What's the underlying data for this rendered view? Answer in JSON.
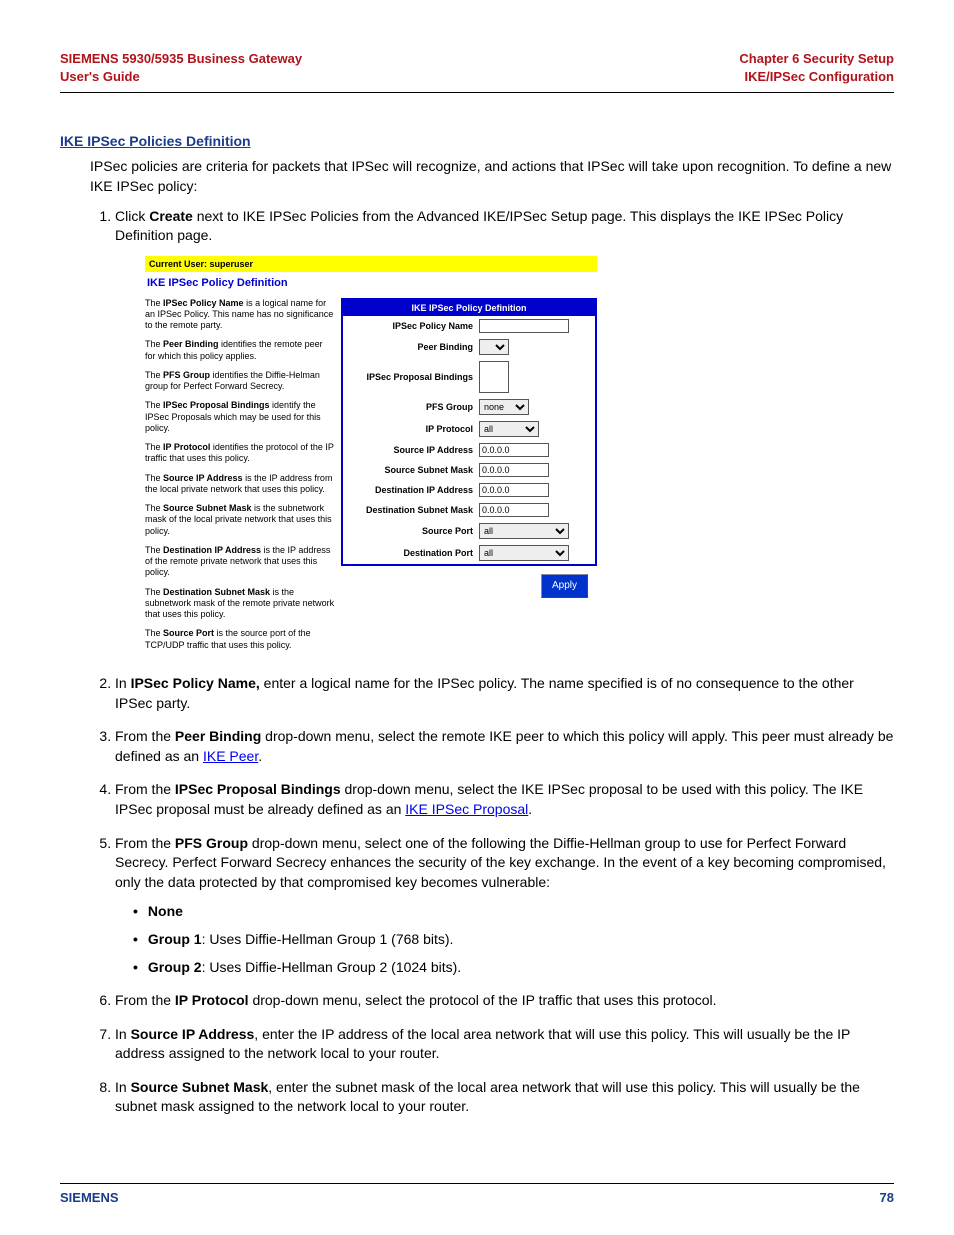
{
  "header": {
    "left_line1": "SIEMENS 5930/5935 Business Gateway",
    "left_line2": "User's Guide",
    "right_line1": "Chapter 6  Security Setup",
    "right_line2": "IKE/IPSec Configuration"
  },
  "section_heading": "IKE IPSec Policies Definition",
  "intro_para": "IPSec policies are criteria for packets that IPSec will recognize, and actions that IPSec will take upon recognition. To define a new IKE IPSec policy:",
  "steps": {
    "s1_a": "Click ",
    "s1_b": "Create",
    "s1_c": " next to IKE IPSec Policies from the Advanced IKE/IPSec Setup page. This displays the IKE IPSec Policy Definition page.",
    "s2_a": "In ",
    "s2_b": "IPSec Policy Name,",
    "s2_c": " enter a logical name for the IPSec policy. The name specified is of no consequence to the other IPSec party.",
    "s3_a": "From the ",
    "s3_b": "Peer Binding",
    "s3_c": " drop-down menu, select the remote IKE peer to which this policy will apply. This peer must already be defined as an ",
    "s3_link": "IKE Peer",
    "s3_d": ".",
    "s4_a": "From the ",
    "s4_b": "IPSec Proposal Bindings",
    "s4_c": " drop-down menu, select the IKE IPSec proposal to be used with this policy. The IKE IPSec proposal must be already defined as an ",
    "s4_link": "IKE IPSec Proposal",
    "s4_d": ".",
    "s5_a": "From the ",
    "s5_b": "PFS Group",
    "s5_c": " drop-down menu, select one of the following the Diffie-Hellman group to use for Perfect Forward Secrecy. Perfect Forward Secrecy enhances the security of the key exchange. In the event of a key becoming compromised, only the data protected by that compromised key becomes vulnerable:",
    "s5_sub": {
      "b1": "None",
      "b2a": "Group 1",
      "b2b": ": Uses Diffie-Hellman Group 1 (768 bits).",
      "b3a": "Group 2",
      "b3b": ": Uses Diffie-Hellman Group 2 (1024 bits)."
    },
    "s6_a": "From the ",
    "s6_b": "IP Protocol",
    "s6_c": " drop-down menu, select the protocol of the IP traffic that uses this protocol.",
    "s7_a": "In ",
    "s7_b": "Source IP Address",
    "s7_c": ", enter the IP address of the local area network that will use this policy. This will usually be the IP address assigned to the network local to your router.",
    "s8_a": "In ",
    "s8_b": "Source Subnet Mask",
    "s8_c": ", enter the subnet mask of the local area network that will use this policy. This will usually be the subnet mask assigned to the network local to your router."
  },
  "screenshot": {
    "userbar": "Current User: superuser",
    "title": "IKE IPSec Policy Definition",
    "panel_head": "IKE IPSec Policy Definition",
    "help": {
      "p1a": "The ",
      "p1b": "IPSec Policy Name",
      "p1c": " is a logical name for an IPSec Policy. This name has no significance to the remote party.",
      "p2a": "The ",
      "p2b": "Peer Binding",
      "p2c": " identifies the remote peer for which this policy applies.",
      "p3a": "The ",
      "p3b": "PFS Group",
      "p3c": " identifies the Diffie-Helman group for Perfect Forward Secrecy.",
      "p4a": "The ",
      "p4b": "IPSec Proposal Bindings",
      "p4c": " identify the IPSec Proposals which may be used for this policy.",
      "p5a": "The ",
      "p5b": "IP Protocol",
      "p5c": " identifies the protocol of the IP traffic that uses this policy.",
      "p6a": "The ",
      "p6b": "Source IP Address",
      "p6c": " is the IP address from the local private network that uses this policy.",
      "p7a": "The ",
      "p7b": "Source Subnet Mask",
      "p7c": " is the subnetwork mask of the local private network that uses this policy.",
      "p8a": "The ",
      "p8b": "Destination IP Address",
      "p8c": " is the IP address of the remote private network that uses this policy.",
      "p9a": "The ",
      "p9b": "Destination Subnet Mask",
      "p9c": " is the subnetwork mask of the remote private network that uses this policy.",
      "p10a": "The ",
      "p10b": "Source Port",
      "p10c": " is the source port of the TCP/UDP traffic that uses this policy."
    },
    "form": {
      "policy_name_label": "IPSec Policy Name",
      "policy_name_value": "",
      "peer_binding_label": "Peer Binding",
      "peer_binding_value": "",
      "proposal_bindings_label": "IPSec Proposal Bindings",
      "pfs_group_label": "PFS Group",
      "pfs_group_value": "none",
      "ip_protocol_label": "IP Protocol",
      "ip_protocol_value": "all",
      "src_ip_label": "Source IP Address",
      "src_ip_value": "0.0.0.0",
      "src_mask_label": "Source Subnet Mask",
      "src_mask_value": "0.0.0.0",
      "dst_ip_label": "Destination IP Address",
      "dst_ip_value": "0.0.0.0",
      "dst_mask_label": "Destination Subnet Mask",
      "dst_mask_value": "0.0.0.0",
      "src_port_label": "Source Port",
      "src_port_value": "all",
      "dst_port_label": "Destination Port",
      "dst_port_value": "all"
    },
    "apply": "Apply"
  },
  "footer": {
    "brand": "SIEMENS",
    "page": "78"
  }
}
